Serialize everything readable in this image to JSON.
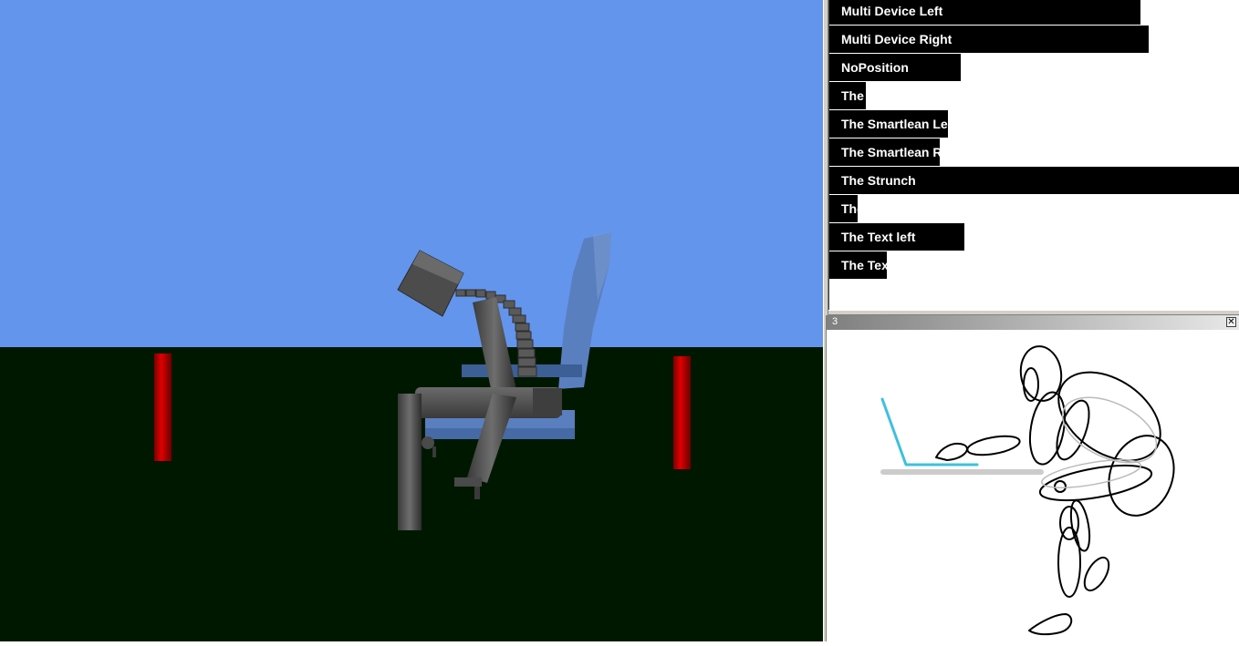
{
  "posture_list": {
    "items": [
      {
        "label": "Multi Device Left",
        "level": 0.76
      },
      {
        "label": "Multi Device Right",
        "level": 0.78
      },
      {
        "label": "NoPosition",
        "level": 0.32
      },
      {
        "label": "The",
        "level": 0.09
      },
      {
        "label": "The Smartlean Left",
        "level": 0.29
      },
      {
        "label": "The Smartlean Right",
        "level": 0.27
      },
      {
        "label": "The Strunch",
        "level": 1.0
      },
      {
        "label": "The",
        "level": 0.07
      },
      {
        "label": "The Text left",
        "level": 0.33
      },
      {
        "label": "The Tex",
        "level": 0.14
      }
    ]
  },
  "subwindow": {
    "title": "3",
    "close_icon": "close-icon"
  },
  "scene": {
    "sky_color": "#6495ed",
    "floor_color": "#001800",
    "pillar_color": "#cc0000",
    "chair_color": "#5a7fbf",
    "figure_color": "#555555"
  },
  "illustration": {
    "laptop_color": "#3ec1dc",
    "desk_color": "#cccccc",
    "outline_color": "#000000"
  }
}
